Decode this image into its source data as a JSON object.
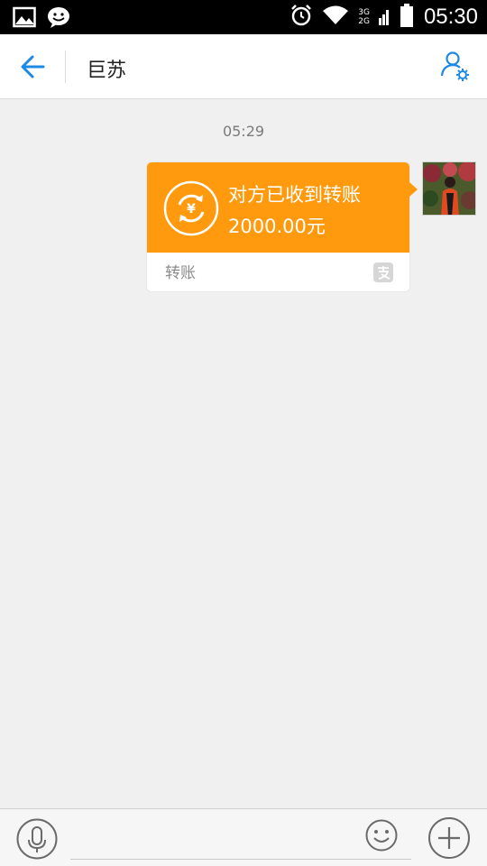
{
  "status_bar": {
    "time": "05:30",
    "network_top": "3G",
    "network_bottom": "2G",
    "icons": [
      "gallery-icon",
      "emoji-notification-icon",
      "alarm-icon",
      "wifi-icon",
      "signal-icon",
      "battery-icon"
    ]
  },
  "header": {
    "title": "巨苏",
    "back_icon": "back-arrow-icon",
    "profile_icon": "user-settings-icon"
  },
  "messages": {
    "timestamp": "05:29",
    "transfer": {
      "status": "对方已收到转账",
      "amount": "2000.00元",
      "label": "转账",
      "accent_color": "#ff9a0e"
    }
  },
  "input_bar": {
    "placeholder": "",
    "icons": [
      "microphone-icon",
      "emoji-icon",
      "plus-icon"
    ]
  },
  "colors": {
    "accent_blue": "#1e88e5",
    "transfer_orange": "#ff9a0e",
    "background": "#f0f0f0"
  }
}
